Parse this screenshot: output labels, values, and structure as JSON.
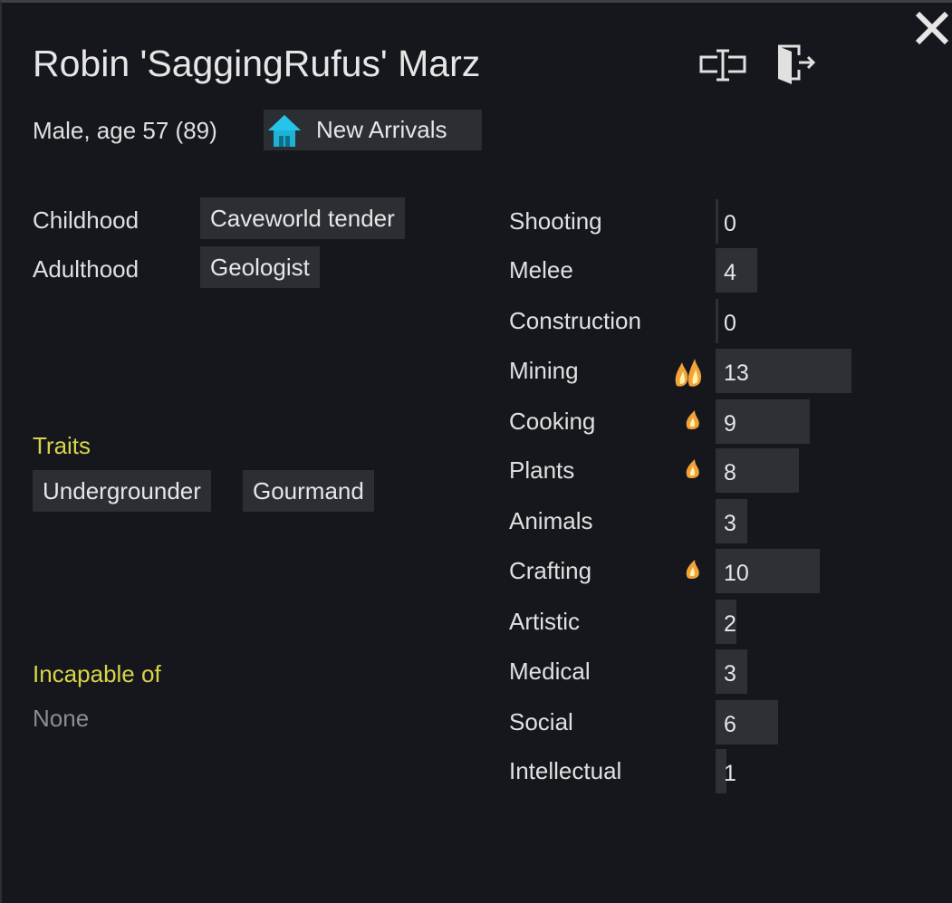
{
  "pawn": {
    "name": "Robin 'SaggingRufus' Marz",
    "description": "Male, age 57 (89)",
    "faction": "New Arrivals"
  },
  "backstory": {
    "childhood_label": "Childhood",
    "childhood_value": "Caveworld tender",
    "adulthood_label": "Adulthood",
    "adulthood_value": "Geologist"
  },
  "traits": {
    "heading": "Traits",
    "items": [
      "Undergrounder",
      "Gourmand"
    ]
  },
  "incapable": {
    "heading": "Incapable of",
    "value": "None"
  },
  "skills": [
    {
      "name": "Shooting",
      "level": 0,
      "passion": 0
    },
    {
      "name": "Melee",
      "level": 4,
      "passion": 0
    },
    {
      "name": "Construction",
      "level": 0,
      "passion": 0
    },
    {
      "name": "Mining",
      "level": 13,
      "passion": 2
    },
    {
      "name": "Cooking",
      "level": 9,
      "passion": 1
    },
    {
      "name": "Plants",
      "level": 8,
      "passion": 1
    },
    {
      "name": "Animals",
      "level": 3,
      "passion": 0
    },
    {
      "name": "Crafting",
      "level": 10,
      "passion": 1
    },
    {
      "name": "Artistic",
      "level": 2,
      "passion": 0
    },
    {
      "name": "Medical",
      "level": 3,
      "passion": 0
    },
    {
      "name": "Social",
      "level": 6,
      "passion": 0
    },
    {
      "name": "Intellectual",
      "level": 1,
      "passion": 0
    }
  ],
  "skill_max_level": 20,
  "colors": {
    "accent_heading": "#d8d44a",
    "faction_icon": "#1fb2d8",
    "passion_flame": "#f2a23a"
  },
  "icons": {
    "close": "close-icon",
    "rename": "rename-icon",
    "banish": "banish-icon",
    "faction": "house-icon",
    "passion_minor": "flame-icon",
    "passion_major": "double-flame-icon"
  }
}
